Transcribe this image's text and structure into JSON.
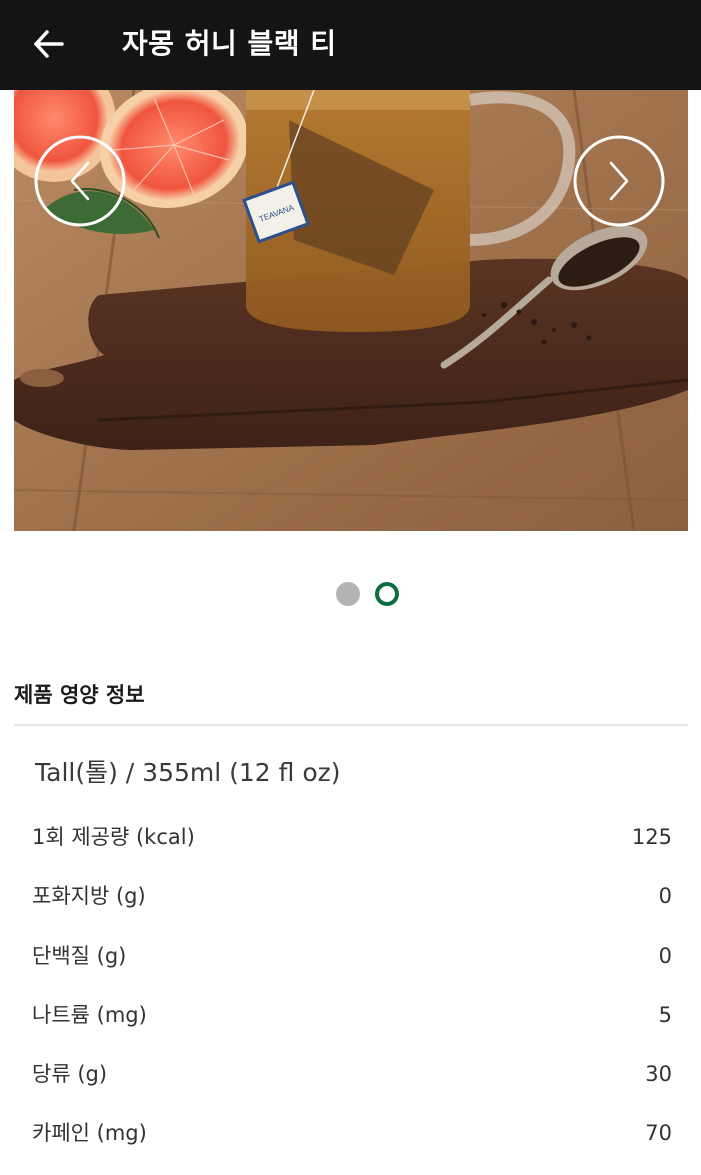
{
  "header": {
    "back_icon": "arrow-left-icon",
    "title": "자몽 허니 블랙 티",
    "background": "#141414"
  },
  "carousel": {
    "prev_icon": "chevron-left-icon",
    "next_icon": "chevron-right-icon",
    "dot_count": 2,
    "active_index": 1,
    "active_color": "#0a6e3e",
    "inactive_color": "#b3b3b3",
    "tag_text": "TEAVANA"
  },
  "nutrition": {
    "title": "제품 영양 정보",
    "size": "Tall(톨) / 355ml (12 fl oz)",
    "rows": [
      {
        "label": "1회 제공량 (kcal)",
        "value": "125"
      },
      {
        "label": "포화지방 (g)",
        "value": "0"
      },
      {
        "label": "단백질 (g)",
        "value": "0"
      },
      {
        "label": "나트륨 (mg)",
        "value": "5"
      },
      {
        "label": "당류 (g)",
        "value": "30"
      },
      {
        "label": "카페인 (mg)",
        "value": "70"
      }
    ]
  }
}
